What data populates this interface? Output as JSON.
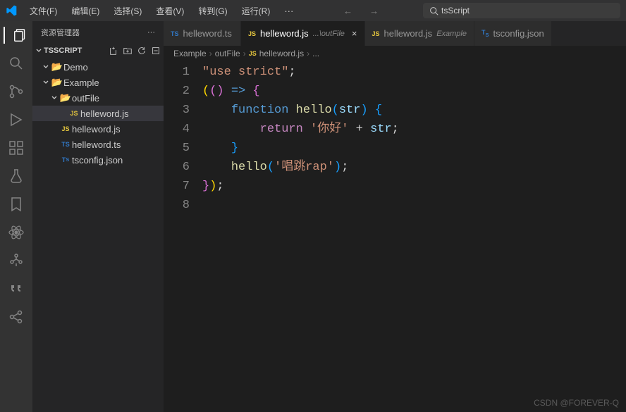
{
  "menu": {
    "file": "文件(F)",
    "edit": "编辑(E)",
    "select": "选择(S)",
    "view": "查看(V)",
    "goto": "转到(G)",
    "run": "运行(R)"
  },
  "search": {
    "text": "tsScript"
  },
  "sidebar": {
    "title": "资源管理器",
    "project": "TSSCRIPT",
    "tree": {
      "demo": "Demo",
      "example": "Example",
      "outfile": "outFile",
      "helleword_js_out": "helleword.js",
      "helleword_js": "helleword.js",
      "helleword_ts": "helleword.ts",
      "tsconfig": "tsconfig.json"
    }
  },
  "tabs": [
    {
      "label": "helleword.ts",
      "type": "ts",
      "suffix": "",
      "active": false
    },
    {
      "label": "helleword.js",
      "type": "js",
      "suffix": "...\\outFile",
      "active": true
    },
    {
      "label": "helleword.js",
      "type": "js",
      "suffix": "Example",
      "active": false
    },
    {
      "label": "tsconfig.json",
      "type": "ts",
      "suffix": "",
      "active": false
    }
  ],
  "breadcrumbs": {
    "p1": "Example",
    "p2": "outFile",
    "p3": "helleword.js",
    "p4": "..."
  },
  "code": {
    "l1_str": "\"use strict\"",
    "l2_arrow": "() ",
    "l2_arrow2": "=>",
    "l3_fn": "function",
    "l3_name": "hello",
    "l3_param": "str",
    "l4_ret": "return",
    "l4_str": "'你好'",
    "l4_plus": " + ",
    "l4_var": "str",
    "l6_call": "hello",
    "l6_arg": "'唱跳rap'"
  },
  "watermark": "CSDN @FOREVER-Q"
}
